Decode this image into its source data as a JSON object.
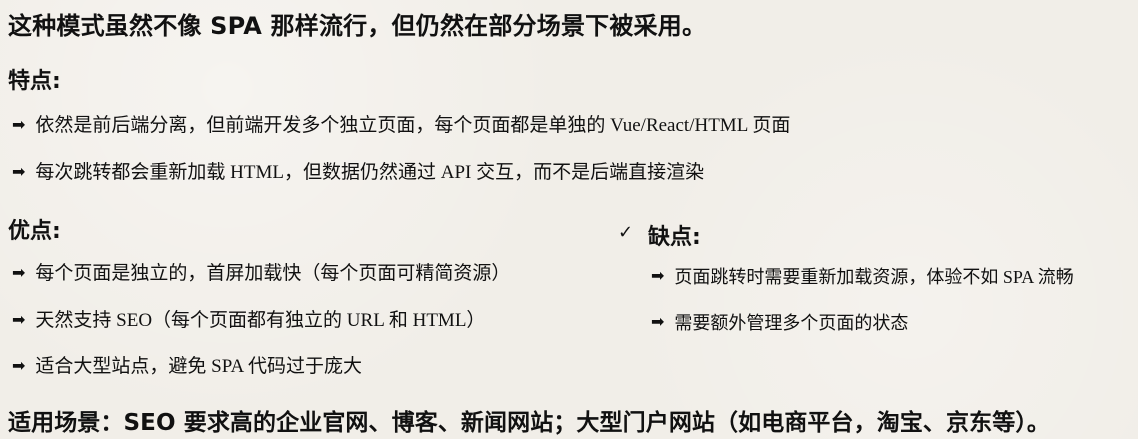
{
  "document": {
    "intro": "这种模式虽然不像 SPA 那样流行，但仍然在部分场景下被采用。",
    "features": {
      "title": "特点:",
      "items": [
        "依然是前后端分离，但前端开发多个独立页面，每个页面都是单独的 Vue/React/HTML 页面",
        "每次跳转都会重新加载 HTML，但数据仍然通过 API 交互，而不是后端直接渲染"
      ]
    },
    "pros": {
      "title": "优点:",
      "items": [
        "每个页面是独立的，首屏加载快（每个页面可精简资源）",
        "天然支持 SEO（每个页面都有独立的 URL 和 HTML）",
        "适合大型站点，避免 SPA 代码过于庞大"
      ]
    },
    "cons": {
      "marker": "✓",
      "title": "缺点:",
      "items": [
        "页面跳转时需要重新加载资源，体验不如 SPA 流畅",
        "需要额外管理多个页面的状态"
      ]
    },
    "footer": "适用场景：SEO 要求高的企业官网、博客、新闻网站；大型门户网站（如电商平台，淘宝、京东等）。",
    "bullet_glyph": "➡"
  }
}
